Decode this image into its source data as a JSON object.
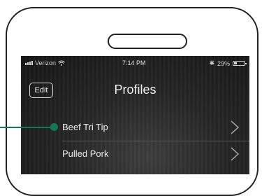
{
  "status_bar": {
    "carrier": "Verizon",
    "time": "7:14 PM",
    "battery_percent": "29%"
  },
  "nav": {
    "edit_label": "Edit",
    "title": "Profiles"
  },
  "profiles": [
    {
      "label": "Beef Tri Tip"
    },
    {
      "label": "Pulled Pork"
    }
  ],
  "colors": {
    "callout": "#0f7a55",
    "phone_outline": "#222222",
    "screen_background": "#262626"
  },
  "icons": {
    "signal": "cellular-signal-icon",
    "wifi": "wifi-icon",
    "bluetooth": "bluetooth-icon",
    "battery": "battery-icon",
    "row_chevron": "chevron-right-icon"
  }
}
